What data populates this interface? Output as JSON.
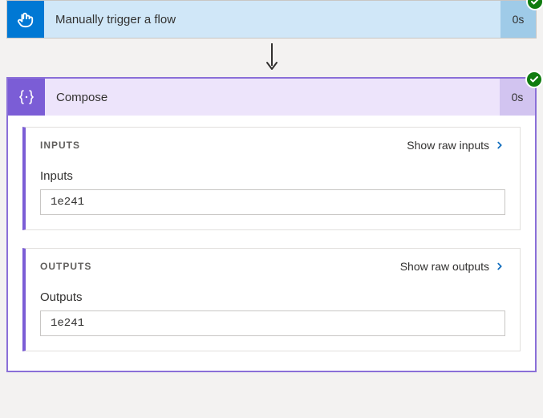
{
  "trigger": {
    "title": "Manually trigger a flow",
    "duration": "0s"
  },
  "action": {
    "title": "Compose",
    "duration": "0s",
    "inputs": {
      "section_label": "INPUTS",
      "raw_label": "Show raw inputs",
      "field_label": "Inputs",
      "value": "1e241"
    },
    "outputs": {
      "section_label": "OUTPUTS",
      "raw_label": "Show raw outputs",
      "field_label": "Outputs",
      "value": "1e241"
    }
  }
}
